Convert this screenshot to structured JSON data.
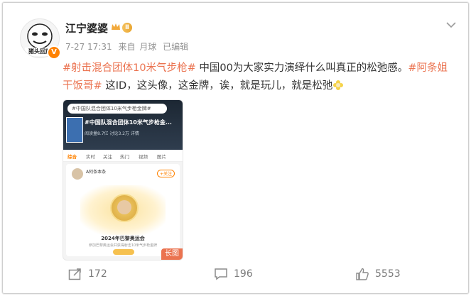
{
  "post": {
    "author": "江宁婆婆",
    "level_badge": "Ⅱ",
    "avatar_caption": "猪头回放",
    "time": "7-27 17:31",
    "source_prefix": "来自",
    "source": "月球",
    "edited": "已编辑",
    "topic1": "#射击混合团体10米气步枪#",
    "text1": " 中国00为大家实力演绎什么叫真正的松弛感。",
    "topic2": "#阿条姐 干饭哥#",
    "text2": " 这ID，这头像，这金牌，诶，就是玩儿，就是松弛"
  },
  "thumbnail": {
    "search_text": "#中国队混合团体10米气步枪金牌#",
    "title": "#中国队混合团体10米气步枪金...",
    "stats": "阅读量8.7亿  讨论3.2万  详情",
    "tabs": [
      "综合",
      "实时",
      "关注",
      "热门",
      "视频",
      "图片"
    ],
    "card_user": "A阿条本条",
    "card_follow": "+关注",
    "caption": "2024年巴黎奥运会",
    "sub": "参加巴黎奥运会并获得射击10米气步枪金牌",
    "tag": "长图"
  },
  "actions": {
    "reposts": "172",
    "comments": "196",
    "likes": "5553"
  },
  "colors": {
    "topic": "#eb7350",
    "vip": "#ff8200",
    "meta": "#939393"
  }
}
